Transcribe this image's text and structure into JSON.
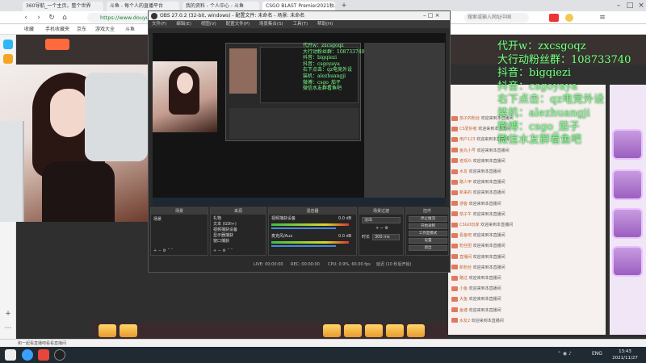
{
  "browser": {
    "tabs": [
      {
        "label": "360导航_一个主页，整个世界"
      },
      {
        "label": "斗鱼 - 每个人的直播平台"
      },
      {
        "label": "我的资料 - 个人中心 - 斗鱼"
      },
      {
        "label": "CSGO BLAST Premier2021秋..."
      }
    ],
    "url": "https://www.douyu.com/",
    "bookmarks": [
      "收藏",
      "手机收藏夹",
      "京东",
      "游戏大全",
      "斗鱼"
    ],
    "search_placeholder": "搜索或输入网址中国"
  },
  "obs": {
    "title": "OBS 27.0.2 (32-bit, windows) - 配置文件: 未命名 - 场景: 未命名",
    "menu": [
      "文件(F)",
      "编辑(E)",
      "视图(V)",
      "配置文件(P)",
      "场景集合(S)",
      "工具(T)",
      "帮助(H)"
    ],
    "scenes_header": "场景",
    "scene_item": "场景",
    "sources_header": "来源",
    "sources": [
      "礼物",
      "文本 (GDI+)",
      "视频捕获设备",
      "显示器捕获",
      "窗口捕获"
    ],
    "mixer_header": "混音器",
    "mixer_tracks": [
      {
        "name": "视频捕获设备",
        "db": "0.0 dB"
      },
      {
        "name": "麦克风/Aux",
        "db": "0.0 dB"
      }
    ],
    "transitions_header": "场景过渡",
    "transition_value": "淡出",
    "duration_label": "时长",
    "duration_value": "300 ms",
    "controls_header": "控件",
    "controls": [
      "停止推流",
      "开始录制",
      "工作室模式",
      "设置",
      "退出"
    ],
    "status": {
      "live": "LIVE: 00:00:00",
      "rec": "REC: 00:00:00",
      "cpu": "CPU: 0.9%, 60.00 fps",
      "delay": "延迟 (10 秒后开始)"
    }
  },
  "overlay_lines": [
    "代开w：zxcsgoqz",
    "大行动粉丝群：108733740",
    "抖音：bigqiezi",
    "抖音：csgoyaya",
    "右下点击：qz电竞外设",
    "装机：alezhuangji",
    "微博：csgo_茄子",
    "微信水友群看鱼吧"
  ],
  "chat": [
    {
      "user": "茄子的粉丝",
      "text": "欢迎来到本直播间"
    },
    {
      "user": "CS爱好者",
      "text": "欢迎来到本直播间"
    },
    {
      "user": "用户123",
      "text": "欢迎来到本直播间"
    },
    {
      "user": "鱼丸小号",
      "text": "欢迎来到本直播间"
    },
    {
      "user": "老观众",
      "text": "欢迎来到本直播间"
    },
    {
      "user": "水友",
      "text": "欢迎来到本直播间"
    },
    {
      "user": "路人甲",
      "text": "欢迎来到本直播间"
    },
    {
      "user": "新来的",
      "text": "欢迎来到本直播间"
    },
    {
      "user": "游客",
      "text": "欢迎来到本直播间"
    },
    {
      "user": "茄子牛",
      "text": "欢迎来到本直播间"
    },
    {
      "user": "CSGO玩家",
      "text": "欢迎来到本直播间"
    },
    {
      "user": "看鱼吧",
      "text": "欢迎来到本直播间"
    },
    {
      "user": "粉丝团",
      "text": "欢迎来到本直播间"
    },
    {
      "user": "直播间",
      "text": "欢迎来到本直播间"
    },
    {
      "user": "新粉丝",
      "text": "欢迎来到本直播间"
    },
    {
      "user": "路过",
      "text": "欢迎来到本直播间"
    },
    {
      "user": "小鱼",
      "text": "欢迎来到本直播间"
    },
    {
      "user": "大鱼",
      "text": "欢迎来到本直播间"
    },
    {
      "user": "鱼塘",
      "text": "欢迎来到本直播间"
    },
    {
      "user": "水友2",
      "text": "欢迎来到本直播间"
    }
  ],
  "statusbar": "和一起看直播吧看看直播间",
  "clock": {
    "time": "13:43",
    "date": "2021/11/27"
  },
  "taskbar": {
    "lang": "ENG"
  }
}
